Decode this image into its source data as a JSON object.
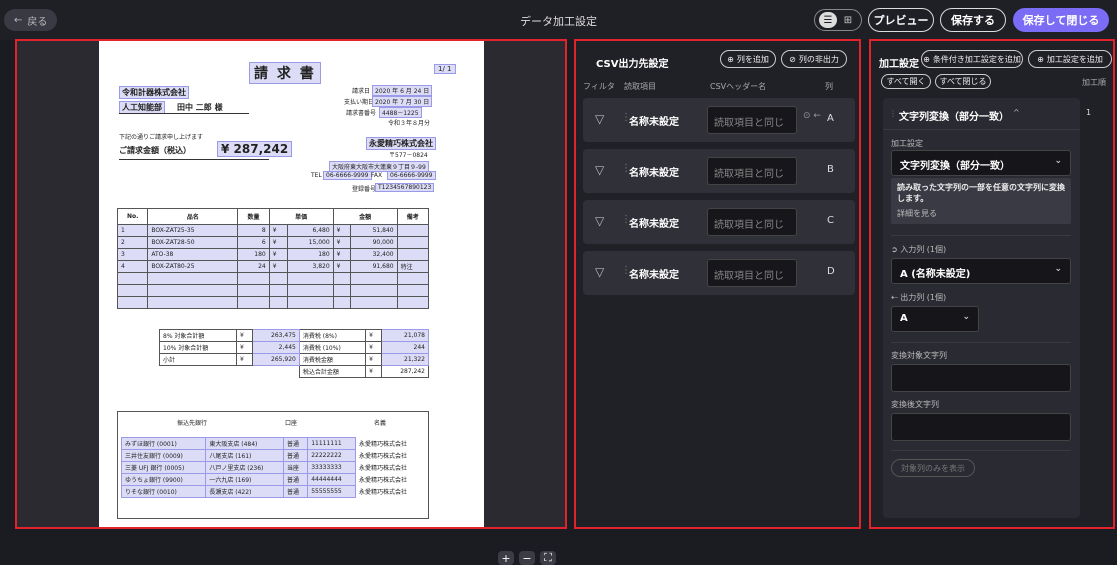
{
  "header": {
    "back_label": "戻る",
    "title": "データ加工設定",
    "preview_label": "プレビュー",
    "save_label": "保存する",
    "save_close_label": "保存して閉じる"
  },
  "document": {
    "page_indicator": "1/ 1",
    "title": "請 求 書",
    "customer_company": "令和計器株式会社",
    "customer_dept": "人工知能部",
    "customer_person": "田中 二郎 様",
    "issue_date_label": "請求日",
    "issue_date": "2020 年 6 月 24 日",
    "due_date_label": "支払い期日",
    "due_date": "2020 年 7 月 30 日",
    "invoice_no_label": "請求書番号",
    "invoice_no": "4488－1225",
    "era_date": "令和３年８月分",
    "greeting": "下記の通りご請求申し上げます",
    "amount_label": "ご請求金額（税込）",
    "amount_value": "¥ 287,242",
    "issuer_company": "永愛精巧株式会社",
    "issuer_zip": "〒577－0824",
    "issuer_address": "大阪府東大阪市大蓮東９丁目９-99",
    "issuer_tel_label": "TEL",
    "issuer_tel": "06-6666-9999",
    "issuer_fax_label": "FAX",
    "issuer_fax": "06-6666-9999",
    "issuer_reg_label": "登録番号",
    "issuer_reg": "T1234567890123",
    "items_headers": [
      "No.",
      "品名",
      "数量",
      "単価",
      "",
      "金額",
      "備考"
    ],
    "items": [
      {
        "no": "1",
        "name": "BOX-ZAT25-35",
        "qty": "8",
        "yen1": "¥",
        "price": "6,480",
        "yen2": "¥",
        "amount": "51,840",
        "note": ""
      },
      {
        "no": "2",
        "name": "BOX-ZAT28-50",
        "qty": "6",
        "yen1": "¥",
        "price": "15,000",
        "yen2": "¥",
        "amount": "90,000",
        "note": ""
      },
      {
        "no": "3",
        "name": "ATO-38",
        "qty": "180",
        "yen1": "¥",
        "price": "180",
        "yen2": "¥",
        "amount": "32,400",
        "note": ""
      },
      {
        "no": "4",
        "name": "BOX-ZAT80-25",
        "qty": "24",
        "yen1": "¥",
        "price": "3,820",
        "yen2": "¥",
        "amount": "91,680",
        "note": "特注"
      }
    ],
    "summary": [
      {
        "label": "8% 対象合計額",
        "yen": "¥",
        "value": "263,475",
        "tax_label": "消費税 (8%)",
        "tax_yen": "¥",
        "tax_value": "21,078"
      },
      {
        "label": "10% 対象合計額",
        "yen": "¥",
        "value": "2,445",
        "tax_label": "消費税 (10%)",
        "tax_yen": "¥",
        "tax_value": "244"
      },
      {
        "label": "小計",
        "yen": "¥",
        "value": "265,920",
        "tax_label": "消費税金額",
        "tax_yen": "¥",
        "tax_value": "21,322"
      }
    ],
    "grand_total_label": "税込合計金額",
    "grand_total_yen": "¥",
    "grand_total_value": "287,242",
    "bank_headers": [
      "振込先銀行",
      "口座",
      "名義"
    ],
    "banks": [
      {
        "bank": "みずほ銀行 (0001)",
        "branch": "東大阪支店 (484)",
        "type": "普通",
        "account": "11111111",
        "holder": "永愛精巧株式会社"
      },
      {
        "bank": "三井住友銀行 (0009)",
        "branch": "八尾支店 (161)",
        "type": "普通",
        "account": "22222222",
        "holder": "永愛精巧株式会社"
      },
      {
        "bank": "三菱 UFJ 銀行 (0005)",
        "branch": "八戸ノ里支店 (236)",
        "type": "当座",
        "account": "33333333",
        "holder": "永愛精巧株式会社"
      },
      {
        "bank": "ゆうちょ銀行 (9900)",
        "branch": "一六九店 (169)",
        "type": "普通",
        "account": "44444444",
        "holder": "永愛精巧株式会社"
      },
      {
        "bank": "りそな銀行 (0010)",
        "branch": "長瀬支店 (422)",
        "type": "普通",
        "account": "55555555",
        "holder": "永愛精巧株式会社"
      }
    ]
  },
  "csv_panel": {
    "title": "CSV出力先設定",
    "add_column_label": "列を追加",
    "hide_column_label": "列の非出力",
    "col_filter": "フィルタ",
    "col_read_item": "読取項目",
    "col_csv_header": "CSVヘッダー名",
    "col_column": "列",
    "rows": [
      {
        "name": "名称未設定",
        "placeholder": "読取項目と同じ",
        "letter": "A"
      },
      {
        "name": "名称未設定",
        "placeholder": "読取項目と同じ",
        "letter": "B"
      },
      {
        "name": "名称未設定",
        "placeholder": "読取項目と同じ",
        "letter": "C"
      },
      {
        "name": "名称未設定",
        "placeholder": "読取項目と同じ",
        "letter": "D"
      }
    ]
  },
  "proc_panel": {
    "title": "加工設定",
    "add_conditional_label": "条件付き加工設定を追加",
    "add_proc_label": "加工設定を追加",
    "expand_all_label": "すべて開く",
    "collapse_all_label": "すべて閉じる",
    "col_order": "加工順",
    "card_title": "文字列変換（部分一致）",
    "order_no": "1",
    "proc_setting_label": "加工設定",
    "proc_setting_value": "文字列変換（部分一致）",
    "description": "読み取った文字列の一部を任意の文字列に変換します。",
    "details_link": "詳細を見る",
    "input_col_label": "入力列 (1個)",
    "input_col_value": "A (名称未設定)",
    "output_col_label": "出力列 (1個)",
    "output_col_value": "A",
    "target_string_label": "変換対象文字列",
    "replacement_string_label": "変換後文字列",
    "show_target_only_label": "対象列のみを表示"
  }
}
